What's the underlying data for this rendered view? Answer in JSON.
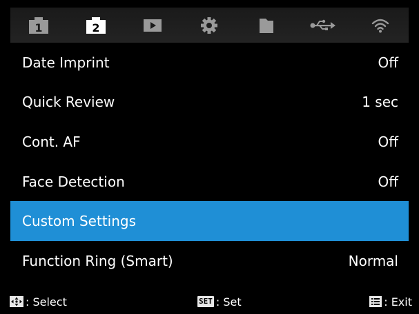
{
  "tabs": [
    {
      "icon": "camera-1-tab-icon",
      "label": "1",
      "active": false
    },
    {
      "icon": "camera-2-tab-icon",
      "label": "2",
      "active": true
    },
    {
      "icon": "playback-tab-icon",
      "active": false
    },
    {
      "icon": "gear-tab-icon",
      "active": false
    },
    {
      "icon": "folder-tab-icon",
      "active": false
    },
    {
      "icon": "usb-tab-icon",
      "active": false
    },
    {
      "icon": "wifi-tab-icon",
      "active": false
    }
  ],
  "menu": {
    "items": [
      {
        "label": "Date Imprint",
        "value": "Off"
      },
      {
        "label": "Quick Review",
        "value": "1 sec"
      },
      {
        "label": "Cont. AF",
        "value": "Off"
      },
      {
        "label": "Face Detection",
        "value": "Off"
      },
      {
        "label": "Custom Settings",
        "value": ""
      },
      {
        "label": "Function Ring (Smart)",
        "value": "Normal"
      }
    ],
    "selected_index": 4
  },
  "footer": {
    "select_label": ": Select",
    "set_key": "SET",
    "set_label": ": Set",
    "exit_label": ": Exit"
  },
  "colors": {
    "background": "#000000",
    "selection": "#1f8fd6",
    "tab_bar": "#1e1e1e",
    "tab_icon_inactive": "#9a9a9a",
    "tab_icon_active": "#ffffff"
  }
}
